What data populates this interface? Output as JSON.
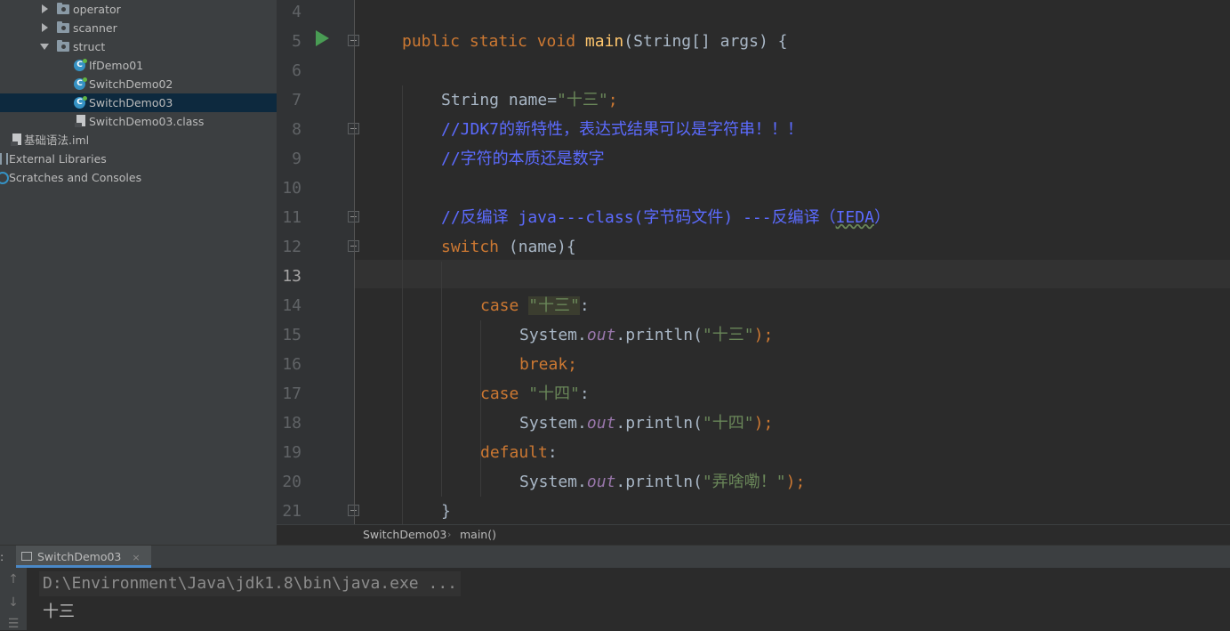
{
  "project_tree": {
    "items": [
      {
        "label": "operator",
        "icon": "folder-icon"
      },
      {
        "label": "scanner",
        "icon": "folder-icon"
      },
      {
        "label": "struct",
        "icon": "folder-icon"
      },
      {
        "label": "IfDemo01",
        "icon": "java-class-icon"
      },
      {
        "label": "SwitchDemo02",
        "icon": "java-class-icon"
      },
      {
        "label": "SwitchDemo03",
        "icon": "java-class-icon",
        "selected": true
      },
      {
        "label": "SwitchDemo03.class",
        "icon": "class-file-icon"
      },
      {
        "label": "基础语法.iml",
        "icon": "iml-file-icon"
      },
      {
        "label": "External Libraries",
        "icon": "library-icon"
      },
      {
        "label": "Scratches and Consoles",
        "icon": "scratches-icon"
      }
    ]
  },
  "editor": {
    "line_numbers": [
      "4",
      "5",
      "6",
      "7",
      "8",
      "9",
      "10",
      "11",
      "12",
      "13",
      "14",
      "15",
      "16",
      "17",
      "18",
      "19",
      "20",
      "21"
    ],
    "current_line": "13",
    "lines": {
      "l5": {
        "kw": "public static void ",
        "method": "main",
        "rest": "(String[] args) {"
      },
      "l7": {
        "pre": "String name=",
        "str": "\"十三\"",
        "semi": ";"
      },
      "l8": "//JDK7的新特性，表达式结果可以是字符串！！！",
      "l9": "//字符的本质还是数字",
      "l11": {
        "pre": "//反编译 java---class(字节码文件) ---反编译（",
        "typo": "IEDA",
        "post": "）"
      },
      "l12": {
        "kw": "switch",
        "rest": " (name){"
      },
      "l14": {
        "kw": "case ",
        "str": "\"十三\"",
        "rest": ":"
      },
      "l15": {
        "pre": "System.",
        "field": "out",
        "mid": ".println(",
        "str": "\"十三\"",
        "post": ");"
      },
      "l16": {
        "kw": "break;"
      },
      "l17": {
        "kw": "case ",
        "str": "\"十四\"",
        "rest": ":"
      },
      "l18": {
        "pre": "System.",
        "field": "out",
        "mid": ".println(",
        "str": "\"十四\"",
        "post": ");"
      },
      "l19": {
        "kw": "default",
        "rest": ":"
      },
      "l20": {
        "pre": "System.",
        "field": "out",
        "mid": ".println(",
        "str": "\"弄啥嘞！\"",
        "post": ");"
      },
      "l21": "}"
    }
  },
  "breadcrumb": {
    "class": "SwitchDemo03",
    "separator": "›",
    "method": "main()"
  },
  "run_panel": {
    "label_prefix": ":",
    "tab_label": "SwitchDemo03",
    "tab_close": "×",
    "command": "D:\\Environment\\Java\\jdk1.8\\bin\\java.exe ...",
    "output": "十三",
    "side_buttons": [
      "↑",
      "↓",
      "☰"
    ]
  },
  "colors": {
    "keyword": "#cc7832",
    "method": "#ffc66d",
    "string": "#6a8759",
    "comment": "#5c6bff",
    "field": "#9876aa",
    "selection": "#0d293e"
  }
}
